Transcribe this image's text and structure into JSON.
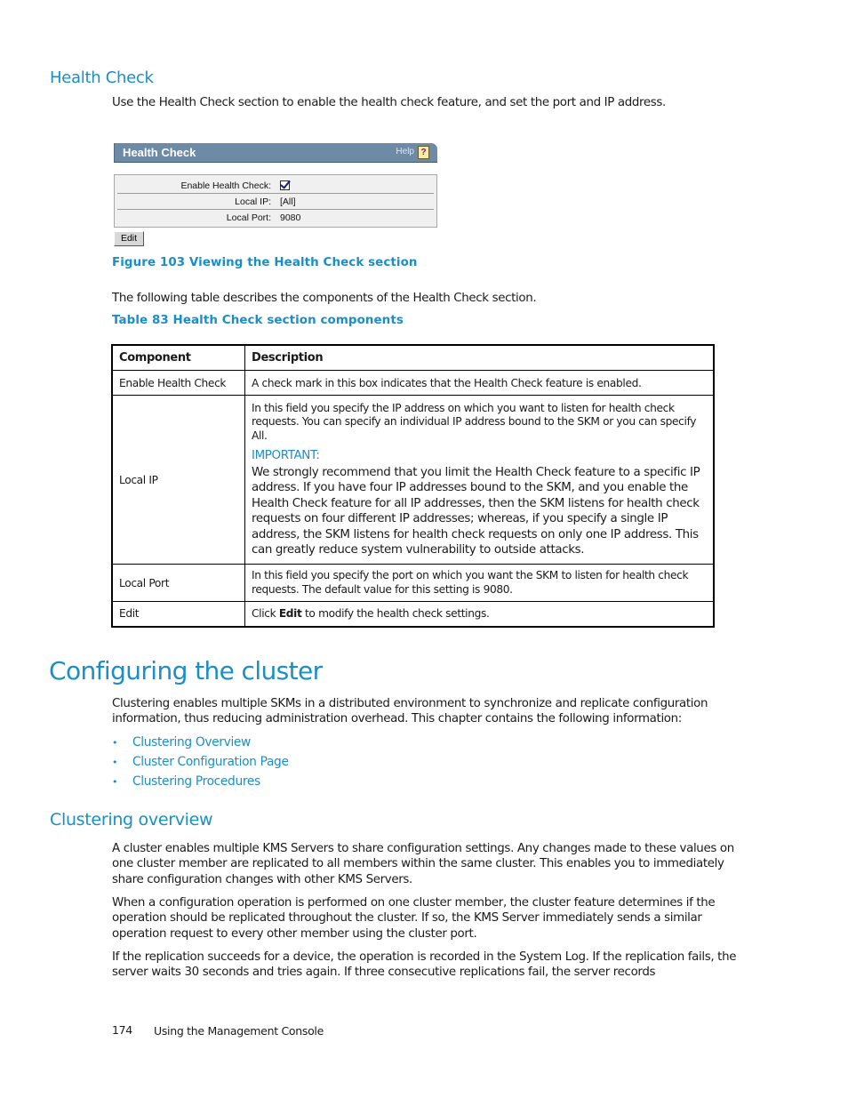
{
  "health_check_section": {
    "heading": "Health Check",
    "intro": "Use the Health Check section to enable the health check feature, and set the port and IP address."
  },
  "figure": {
    "panel_title": "Health Check",
    "help_label": "Help",
    "help_icon": "help-question-icon",
    "fields": [
      {
        "label": "Enable Health Check:",
        "type": "checkbox",
        "checked": true
      },
      {
        "label": "Local IP:",
        "value": "[All]"
      },
      {
        "label": "Local Port:",
        "value": "9080"
      }
    ],
    "edit_button": "Edit",
    "caption": "Figure 103 Viewing the Health Check section"
  },
  "table_intro": "The following table describes the components of the Health Check section.",
  "table": {
    "caption": "Table 83 Health Check section components",
    "headers": [
      "Component",
      "Description"
    ],
    "rows": [
      {
        "component": "Enable Health Check",
        "description": "A check mark in this box indicates that the Health Check feature is enabled."
      },
      {
        "component": "Local IP",
        "description": "In this field you specify the IP address on which you want to listen for health check requests.  You can specify an individual IP address bound to the SKM or you can specify All.",
        "important_label": "IMPORTANT:",
        "important_text": "We strongly recommend that you limit the Health Check feature to a specific IP address. If you have four IP addresses bound to the SKM, and you enable the Health Check feature for all IP addresses, then the SKM listens for health check requests on four different IP addresses; whereas, if you specify a single IP address, the SKM listens for health check requests on only one IP address. This can greatly reduce system vulnerability to outside attacks."
      },
      {
        "component": "Local Port",
        "description": "In this field you specify the port on which you want the SKM to listen for health check requests.  The default value for this setting is 9080."
      },
      {
        "component": "Edit",
        "description_prefix": "Click ",
        "description_bold": "Edit",
        "description_suffix": " to modify the health check settings."
      }
    ]
  },
  "cluster_section": {
    "heading": "Configuring the cluster",
    "intro": "Clustering enables multiple SKMs in a distributed environment to synchronize and replicate configuration information, thus reducing administration overhead.  This chapter contains the following information:",
    "links": [
      "Clustering Overview",
      "Cluster Configuration Page",
      "Clustering Procedures"
    ],
    "bullet": "•"
  },
  "overview_section": {
    "heading": "Clustering overview",
    "paragraphs": [
      "A cluster enables multiple KMS Servers to share configuration settings.  Any changes made to these values on one cluster member are replicated to all members within the same cluster.  This enables you to immediately share configuration changes with other KMS Servers.",
      "When a configuration operation is performed on one cluster member, the cluster feature determines if the operation should be replicated throughout the cluster.  If so, the KMS Server immediately sends a similar operation request to every other member using the cluster port.",
      "If the replication succeeds for a device, the operation is recorded in the System Log.  If the replication fails, the server waits 30 seconds and tries again.  If three consecutive replications fail, the server records"
    ]
  },
  "footer": {
    "page_number": "174",
    "title": "Using the Management Console"
  }
}
